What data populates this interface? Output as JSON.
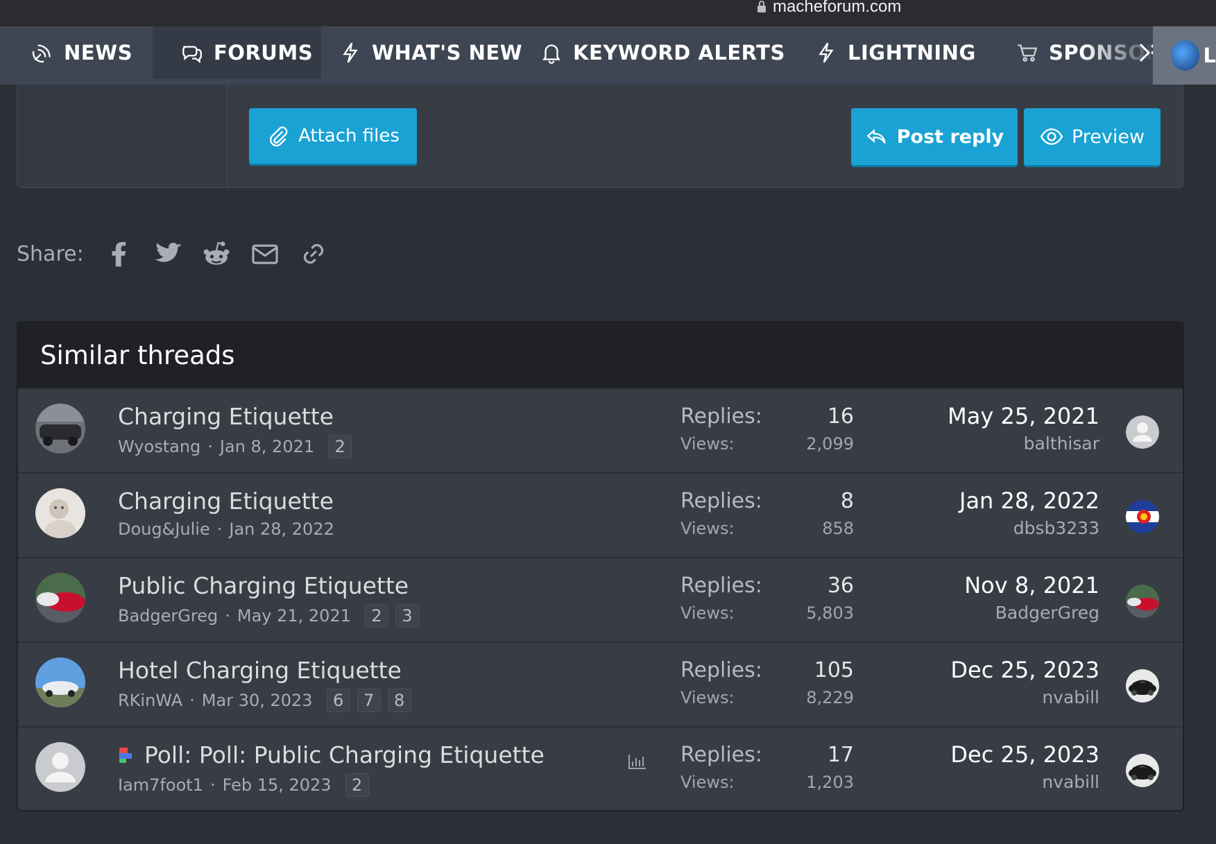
{
  "browser": {
    "url": "macheforum.com"
  },
  "nav": {
    "items": [
      {
        "label": "NEWS",
        "icon": "satellite-dish-icon"
      },
      {
        "label": "FORUMS",
        "icon": "comments-icon",
        "active": true
      },
      {
        "label": "WHAT'S NEW",
        "icon": "bolt-icon"
      },
      {
        "label": "KEYWORD ALERTS",
        "icon": "bell-icon"
      },
      {
        "label": "LIGHTNING",
        "icon": "bolt-icon"
      },
      {
        "label": "SPONSORS",
        "icon": "cart-icon"
      }
    ],
    "overflow_letter": "L"
  },
  "reply": {
    "attach_label": "Attach files",
    "post_reply_label": "Post reply",
    "preview_label": "Preview"
  },
  "share": {
    "label": "Share:",
    "icons": [
      "facebook-icon",
      "twitter-icon",
      "reddit-icon",
      "email-icon",
      "link-icon"
    ]
  },
  "similar": {
    "heading": "Similar threads",
    "replies_label": "Replies:",
    "views_label": "Views:",
    "threads": [
      {
        "title": "Charging Etiquette",
        "author": "Wyostang",
        "date": "Jan 8, 2021",
        "pages": [
          "2"
        ],
        "replies": "16",
        "views": "2,099",
        "last_date": "May 25, 2021",
        "last_user": "balthisar"
      },
      {
        "title": "Charging Etiquette",
        "author": "Doug&Julie",
        "date": "Jan 28, 2022",
        "pages": [],
        "replies": "8",
        "views": "858",
        "last_date": "Jan 28, 2022",
        "last_user": "dbsb3233"
      },
      {
        "title": "Public Charging Etiquette",
        "author": "BadgerGreg",
        "date": "May 21, 2021",
        "pages": [
          "2",
          "3"
        ],
        "replies": "36",
        "views": "5,803",
        "last_date": "Nov 8, 2021",
        "last_user": "BadgerGreg"
      },
      {
        "title": "Hotel Charging Etiquette",
        "author": "RKinWA",
        "date": "Mar 30, 2023",
        "pages": [
          "6",
          "7",
          "8"
        ],
        "replies": "105",
        "views": "8,229",
        "last_date": "Dec 25, 2023",
        "last_user": "nvabill"
      },
      {
        "title": "Poll: Poll: Public Charging Etiquette",
        "author": "Iam7foot1",
        "date": "Feb 15, 2023",
        "pages": [
          "2"
        ],
        "replies": "17",
        "views": "1,203",
        "last_date": "Dec 25, 2023",
        "last_user": "nvabill"
      }
    ]
  },
  "colors": {
    "accent": "#1aa2d4",
    "nav_bg": "#3e4653",
    "page_bg": "#2c2f36",
    "panel_bg": "#383c44",
    "header_bg": "#1f2125"
  }
}
